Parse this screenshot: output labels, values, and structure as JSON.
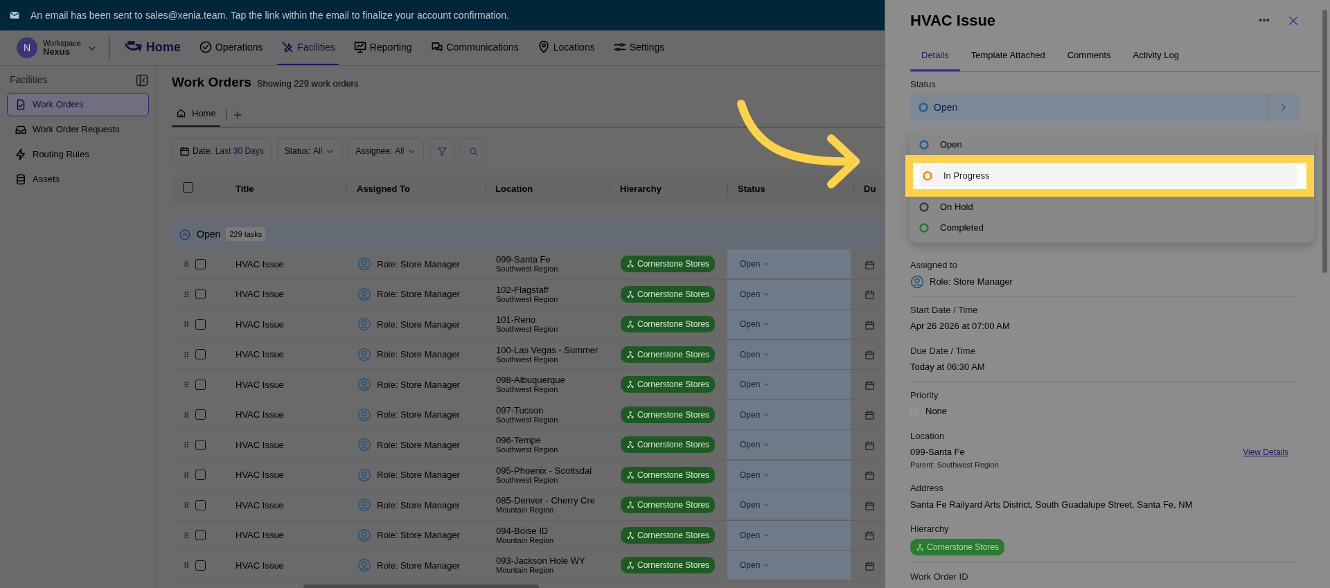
{
  "banner": {
    "text": "An email has been sent to sales@xenia.team. Tap the link within the email to finalize your account confirmation."
  },
  "workspace": {
    "initial": "N",
    "label": "Workspace",
    "name": "Nexus"
  },
  "nav": [
    {
      "label": "Home",
      "kind": "logo",
      "selected": false
    },
    {
      "label": "Operations",
      "kind": "check",
      "selected": false
    },
    {
      "label": "Facilities",
      "kind": "tools",
      "selected": true
    },
    {
      "label": "Reporting",
      "kind": "board",
      "selected": false
    },
    {
      "label": "Communications",
      "kind": "chat",
      "selected": false
    },
    {
      "label": "Locations",
      "kind": "pin",
      "selected": false
    },
    {
      "label": "Settings",
      "kind": "sliders",
      "selected": false
    }
  ],
  "sidebar": {
    "title": "Facilities",
    "items": [
      {
        "label": "Work Orders",
        "kind": "doc",
        "selected": true
      },
      {
        "label": "Work Order Requests",
        "kind": "inbox",
        "selected": false
      },
      {
        "label": "Routing Rules",
        "kind": "bolt",
        "selected": false
      },
      {
        "label": "Assets",
        "kind": "stack",
        "selected": false
      }
    ]
  },
  "page": {
    "title": "Work Orders",
    "subtitle": "Showing 229 work orders"
  },
  "view_tabs": [
    {
      "label": "Home",
      "selected": true
    }
  ],
  "filters": [
    {
      "label": "Date:",
      "value": "Last 30 Days",
      "kind": "date"
    },
    {
      "label": "Status:",
      "value": "All",
      "kind": "dropdown"
    },
    {
      "label": "Assignee:",
      "value": "All",
      "kind": "dropdown"
    }
  ],
  "table": {
    "select_all_checked": false,
    "columns": [
      "Title",
      "Assigned To",
      "Location",
      "Hierarchy",
      "Status",
      "Du"
    ],
    "group": {
      "label": "Open",
      "count": "229 tasks"
    },
    "rows": [
      {
        "checked": false,
        "title": "HVAC Issue",
        "assignee": "Role: Store Manager",
        "location": "099-Santa Fe",
        "region": "Southwest Region",
        "hierarchy": "Cornerstone Stores",
        "status": "Open"
      },
      {
        "checked": false,
        "title": "HVAC Issue",
        "assignee": "Role: Store Manager",
        "location": "102-Flagstaff",
        "region": "Southwest Region",
        "hierarchy": "Cornerstone Stores",
        "status": "Open"
      },
      {
        "checked": false,
        "title": "HVAC Issue",
        "assignee": "Role: Store Manager",
        "location": "101-Reno",
        "region": "Southwest Region",
        "hierarchy": "Cornerstone Stores",
        "status": "Open"
      },
      {
        "checked": false,
        "title": "HVAC Issue",
        "assignee": "Role: Store Manager",
        "location": "100-Las Vegas - Summer",
        "region": "Southwest Region",
        "hierarchy": "Cornerstone Stores",
        "status": "Open"
      },
      {
        "checked": false,
        "title": "HVAC Issue",
        "assignee": "Role: Store Manager",
        "location": "098-Albuquerque",
        "region": "Southwest Region",
        "hierarchy": "Cornerstone Stores",
        "status": "Open"
      },
      {
        "checked": false,
        "title": "HVAC Issue",
        "assignee": "Role: Store Manager",
        "location": "097-Tucson",
        "region": "Southwest Region",
        "hierarchy": "Cornerstone Stores",
        "status": "Open"
      },
      {
        "checked": false,
        "title": "HVAC Issue",
        "assignee": "Role: Store Manager",
        "location": "096-Tempe",
        "region": "Southwest Region",
        "hierarchy": "Cornerstone Stores",
        "status": "Open"
      },
      {
        "checked": false,
        "title": "HVAC Issue",
        "assignee": "Role: Store Manager",
        "location": "095-Phoenix - Scottsdal",
        "region": "Southwest Region",
        "hierarchy": "Cornerstone Stores",
        "status": "Open"
      },
      {
        "checked": false,
        "title": "HVAC Issue",
        "assignee": "Role: Store Manager",
        "location": "085-Denver - Cherry Cre",
        "region": "Mountain Region",
        "hierarchy": "Cornerstone Stores",
        "status": "Open"
      },
      {
        "checked": false,
        "title": "HVAC Issue",
        "assignee": "Role: Store Manager",
        "location": "094-Boise ID",
        "region": "Mountain Region",
        "hierarchy": "Cornerstone Stores",
        "status": "Open"
      },
      {
        "checked": false,
        "title": "HVAC Issue",
        "assignee": "Role: Store Manager",
        "location": "093-Jackson Hole WY",
        "region": "Mountain Region",
        "hierarchy": "Cornerstone Stores",
        "status": "Open"
      }
    ]
  },
  "panel": {
    "title": "HVAC Issue",
    "tabs": [
      {
        "label": "Details",
        "selected": true
      },
      {
        "label": "Template Attached",
        "selected": false
      },
      {
        "label": "Comments",
        "selected": false
      },
      {
        "label": "Activity Log",
        "selected": false
      }
    ],
    "status": {
      "label": "Status",
      "value": "Open",
      "color": "#2a5a9a"
    },
    "status_options": [
      {
        "label": "Open",
        "color": "#2a5a9a",
        "selected": false
      },
      {
        "label": "In Progress",
        "color": "#f08a00",
        "selected": true
      },
      {
        "label": "On Hold",
        "color": "#3a3a3a",
        "selected": false
      },
      {
        "label": "Completed",
        "color": "#1a7a3a",
        "selected": false
      }
    ],
    "assigned": {
      "label": "Assigned to",
      "value": "Role: Store Manager"
    },
    "start": {
      "label": "Start Date / Time",
      "value": "Apr 26 2026 at 07:00 AM"
    },
    "due": {
      "label": "Due Date / Time",
      "value": "Today at 06:30 AM"
    },
    "priority": {
      "label": "Priority",
      "value": "None"
    },
    "location": {
      "label": "Location",
      "value": "099-Santa Fe",
      "parent": "Parent: Southwest Region",
      "link": "View Details"
    },
    "address": {
      "label": "Address",
      "value": "Santa Fe Railyard Arts District, South Guadalupe Street, Santa Fe, NM"
    },
    "hierarchy": {
      "label": "Hierarchy",
      "value": "Cornerstone Stores"
    },
    "work_order_id": {
      "label": "Work Order ID"
    }
  }
}
